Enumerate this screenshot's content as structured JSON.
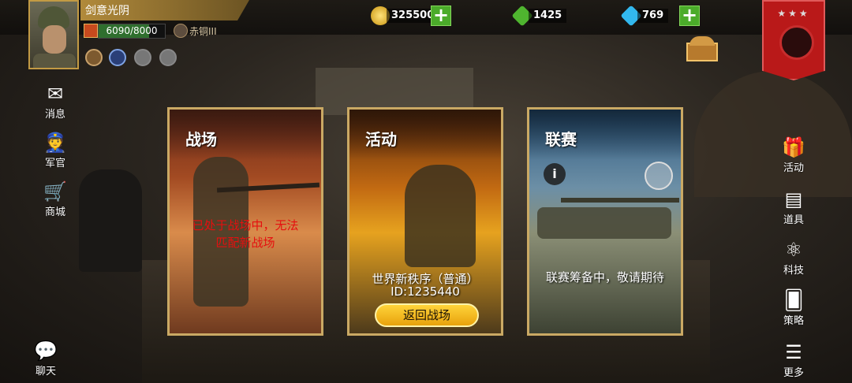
{
  "player": {
    "name": "剑意光阴",
    "xp_text": "6090/8000",
    "xp_fraction": 0.76,
    "rank": "赤铜III"
  },
  "currencies": {
    "gold": "325500",
    "green_gems": "1425",
    "diamonds": "769"
  },
  "left_menu": [
    {
      "label": "消息",
      "icon": "envelope-icon"
    },
    {
      "label": "军官",
      "icon": "officer-icon"
    },
    {
      "label": "商城",
      "icon": "cart-icon"
    }
  ],
  "chat": {
    "label": "聊天",
    "icon": "chat-icon"
  },
  "right_menu": [
    {
      "label": "活动",
      "icon": "gift-icon"
    },
    {
      "label": "道具",
      "icon": "items-icon"
    },
    {
      "label": "科技",
      "icon": "atom-icon"
    },
    {
      "label": "策略",
      "icon": "cards-icon"
    },
    {
      "label": "更多",
      "icon": "list-icon"
    }
  ],
  "cards": {
    "battle": {
      "title": "战场",
      "notice_line1": "已处于战场中，无法",
      "notice_line2": "匹配新战场"
    },
    "event": {
      "title": "活动",
      "name": "世界新秩序（普通）",
      "id": "ID:1235440",
      "button": "返回战场"
    },
    "league": {
      "title": "联赛",
      "status": "联赛筹备中，敬请期待"
    }
  },
  "banner": {
    "stars": "★★★"
  },
  "colors": {
    "card_border": "#caa964",
    "button_gold": "#f2b823",
    "plus_green": "#4bab2a",
    "notice_red": "#e60f0f",
    "banner_red": "#b91919"
  }
}
